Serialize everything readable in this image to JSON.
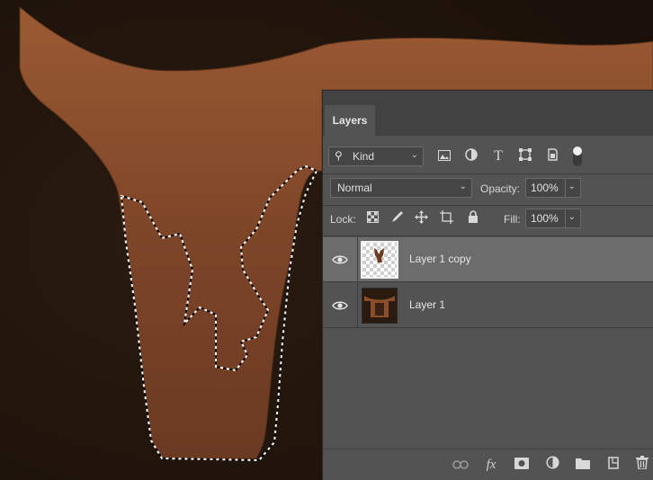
{
  "panel": {
    "tab_label": "Layers",
    "filter": {
      "selected": "Kind",
      "icons": [
        "image-filter-icon",
        "adjustment-filter-icon",
        "type-filter-icon",
        "shape-filter-icon",
        "smart-object-filter-icon",
        "filter-toggle-icon"
      ]
    },
    "blend_mode": "Normal",
    "opacity_label": "Opacity:",
    "opacity_value": "100%",
    "lock_label": "Lock:",
    "lock_icons": [
      "lock-transparent-pixels-icon",
      "lock-image-pixels-icon",
      "lock-position-icon",
      "lock-artboard-icon",
      "lock-all-icon"
    ],
    "fill_label": "Fill:",
    "fill_value": "100%",
    "layers": [
      {
        "name": "Layer 1 copy",
        "visible": true,
        "selected": true
      },
      {
        "name": "Layer 1",
        "visible": true,
        "selected": false
      }
    ],
    "footer_icons": [
      "link-layers-icon",
      "fx-icon",
      "add-mask-icon",
      "new-adjustment-layer-icon",
      "new-group-icon",
      "new-layer-icon",
      "delete-layer-icon"
    ]
  },
  "canvas": {
    "description_colors": {
      "background": "#1e130b",
      "object": "#8a4e2b"
    }
  }
}
